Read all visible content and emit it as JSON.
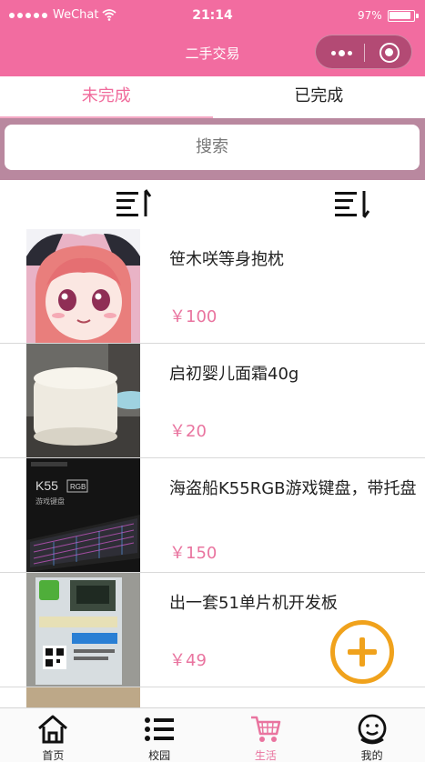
{
  "status_bar": {
    "carrier": "WeChat",
    "time": "21:14",
    "battery": "97%"
  },
  "nav": {
    "title": "二手交易"
  },
  "tabs": [
    {
      "label": "未完成",
      "active": true
    },
    {
      "label": "已完成",
      "active": false
    }
  ],
  "search": {
    "placeholder": "搜索"
  },
  "items": [
    {
      "title": "笹木咲等身抱枕",
      "price": "￥100"
    },
    {
      "title": "启初婴儿面霜40g",
      "price": "￥20"
    },
    {
      "title": "海盗船K55RGB游戏键盘，带托盘",
      "price": "￥150"
    },
    {
      "title": "出一套51单片机开发板",
      "price": "￥49"
    }
  ],
  "thumb_text": {
    "keyboard_brand": "K55",
    "keyboard_rgb": "RGB",
    "keyboard_sub": "游戏键盘"
  },
  "tabbar": [
    {
      "label": "首页",
      "icon": "home-icon"
    },
    {
      "label": "校园",
      "icon": "list-icon"
    },
    {
      "label": "生活",
      "icon": "cart-icon",
      "active": true
    },
    {
      "label": "我的",
      "icon": "user-icon"
    }
  ],
  "colors": {
    "header": "#f26ca0",
    "accent": "#e9749f",
    "search_band": "#b9889f",
    "fab": "#f0a21c"
  }
}
